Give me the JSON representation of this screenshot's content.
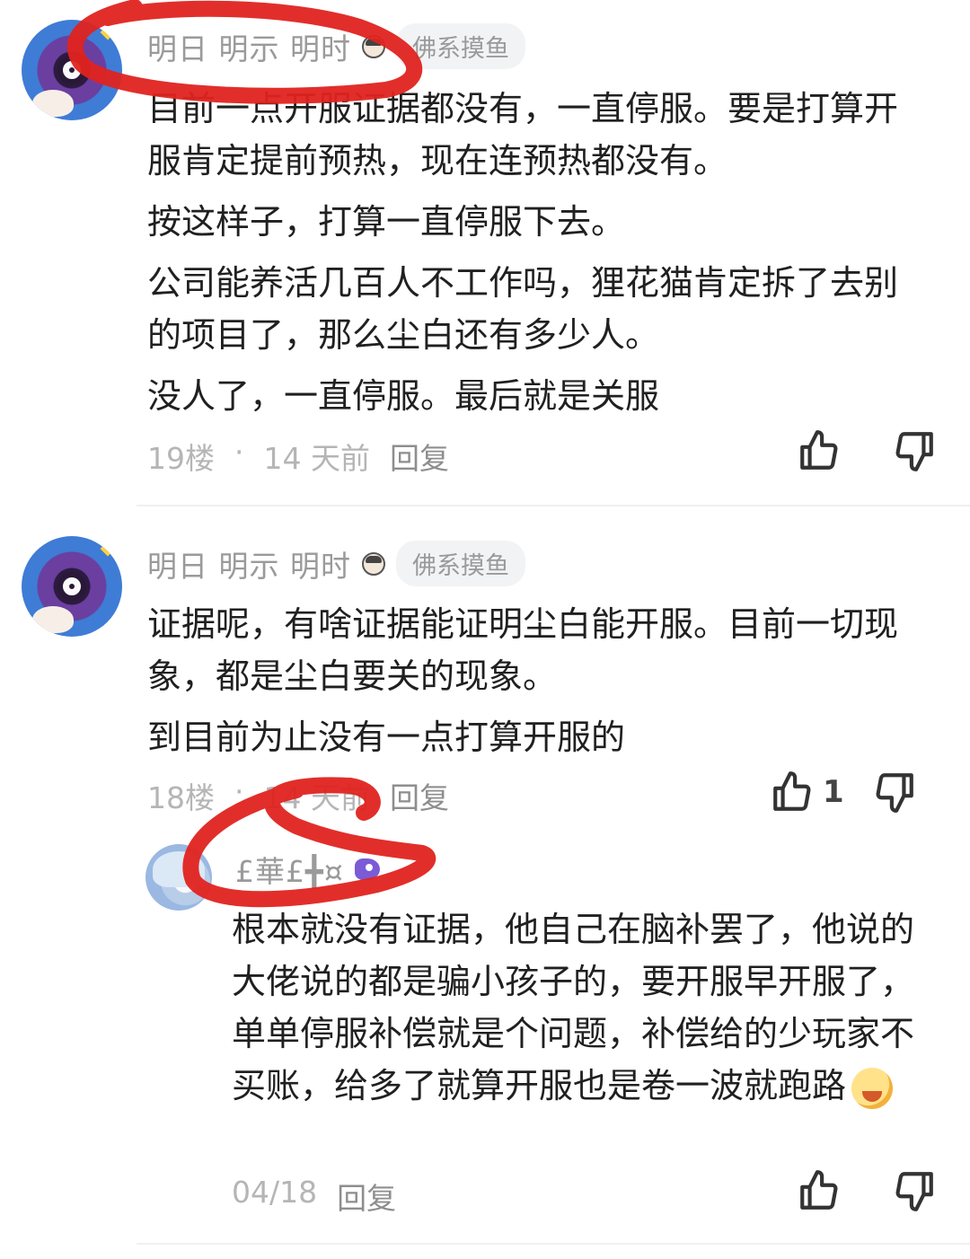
{
  "comments": [
    {
      "username": "明日 明示 明时",
      "badge": "佛系摸鱼",
      "paragraphs": [
        "目前一点开服证据都没有，一直停服。要是打算开服肯定提前预热，现在连预热都没有。",
        "按这样子，打算一直停服下去。",
        "公司能养活几百人不工作吗，狸花猫肯定拆了去别的项目了，那么尘白还有多少人。",
        "没人了，一直停服。最后就是关服"
      ],
      "floor": "19楼",
      "time": "14 天前",
      "reply_label": "回复",
      "like_count": ""
    },
    {
      "username": "明日 明示 明时",
      "badge": "佛系摸鱼",
      "paragraphs": [
        "证据呢，有啥证据能证明尘白能开服。目前一切现象，都是尘白要关的现象。",
        "到目前为止没有一点打算开服的"
      ],
      "floor": "18楼",
      "time": "14 天前",
      "reply_label": "回复",
      "like_count": "1"
    }
  ],
  "reply": {
    "username": "£華£╋¤",
    "text": "根本就没有证据，他自己在脑补罢了，他说的大佬说的都是骗小孩子的，要开服早开服了，单单停服补偿就是个问题，补偿给的少玩家不买账，给多了就算开服也是卷一波就跑路",
    "date": "04/18",
    "reply_label": "回复",
    "like_count": ""
  },
  "icons": {
    "like": "thumbs-up-icon",
    "dislike": "thumbs-down-icon",
    "emoji": "grinning-emoji-icon"
  },
  "colors": {
    "annotation_red": "#e0231f",
    "meta_gray": "#b5b5b5",
    "badge_bg": "#f2f3f5"
  }
}
